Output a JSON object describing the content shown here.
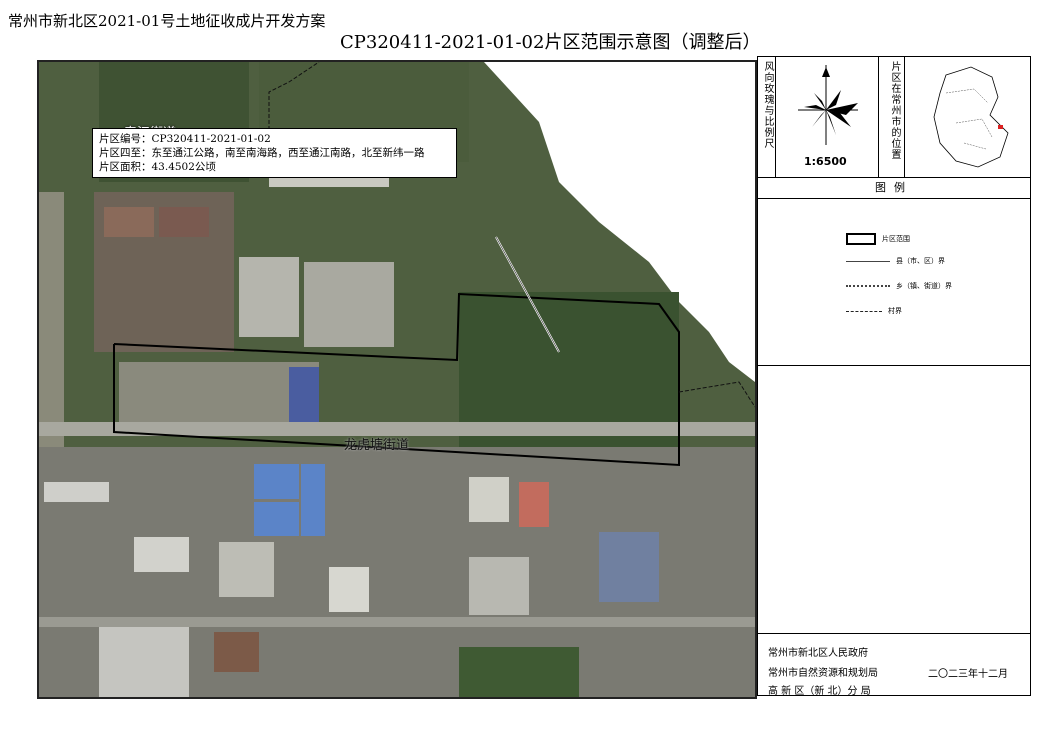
{
  "header": {
    "top_title": "常州市新北区2021-01号土地征收成片开发方案",
    "main_title": "CP320411-2021-01-02片区范围示意图（调整后）"
  },
  "map": {
    "info": {
      "line1": "片区编号：CP320411-2021-01-02",
      "line2": "片区四至：东至通江公路，南至南海路，西至通江南路，北至新纬一路",
      "line3": "片区面积：43.4502公顷"
    },
    "labels": {
      "street_east": "春江街道",
      "street_long": "龙虎塘街道"
    }
  },
  "side": {
    "north_label": "风向玫瑰与比例尺",
    "scale": "1:6500",
    "location_label": "片区在常州市的位置",
    "legend_title": "图例",
    "legend": [
      {
        "label": "片区范围"
      },
      {
        "label": "县（市、区）界"
      },
      {
        "label": "乡（镇、街道）界"
      },
      {
        "label": "村界"
      }
    ],
    "org1": "常州市新北区人民政府",
    "org2": "常州市自然资源和规划局",
    "org3": "高 新 区（新 北）分 局",
    "date": "二〇二三年十二月"
  }
}
